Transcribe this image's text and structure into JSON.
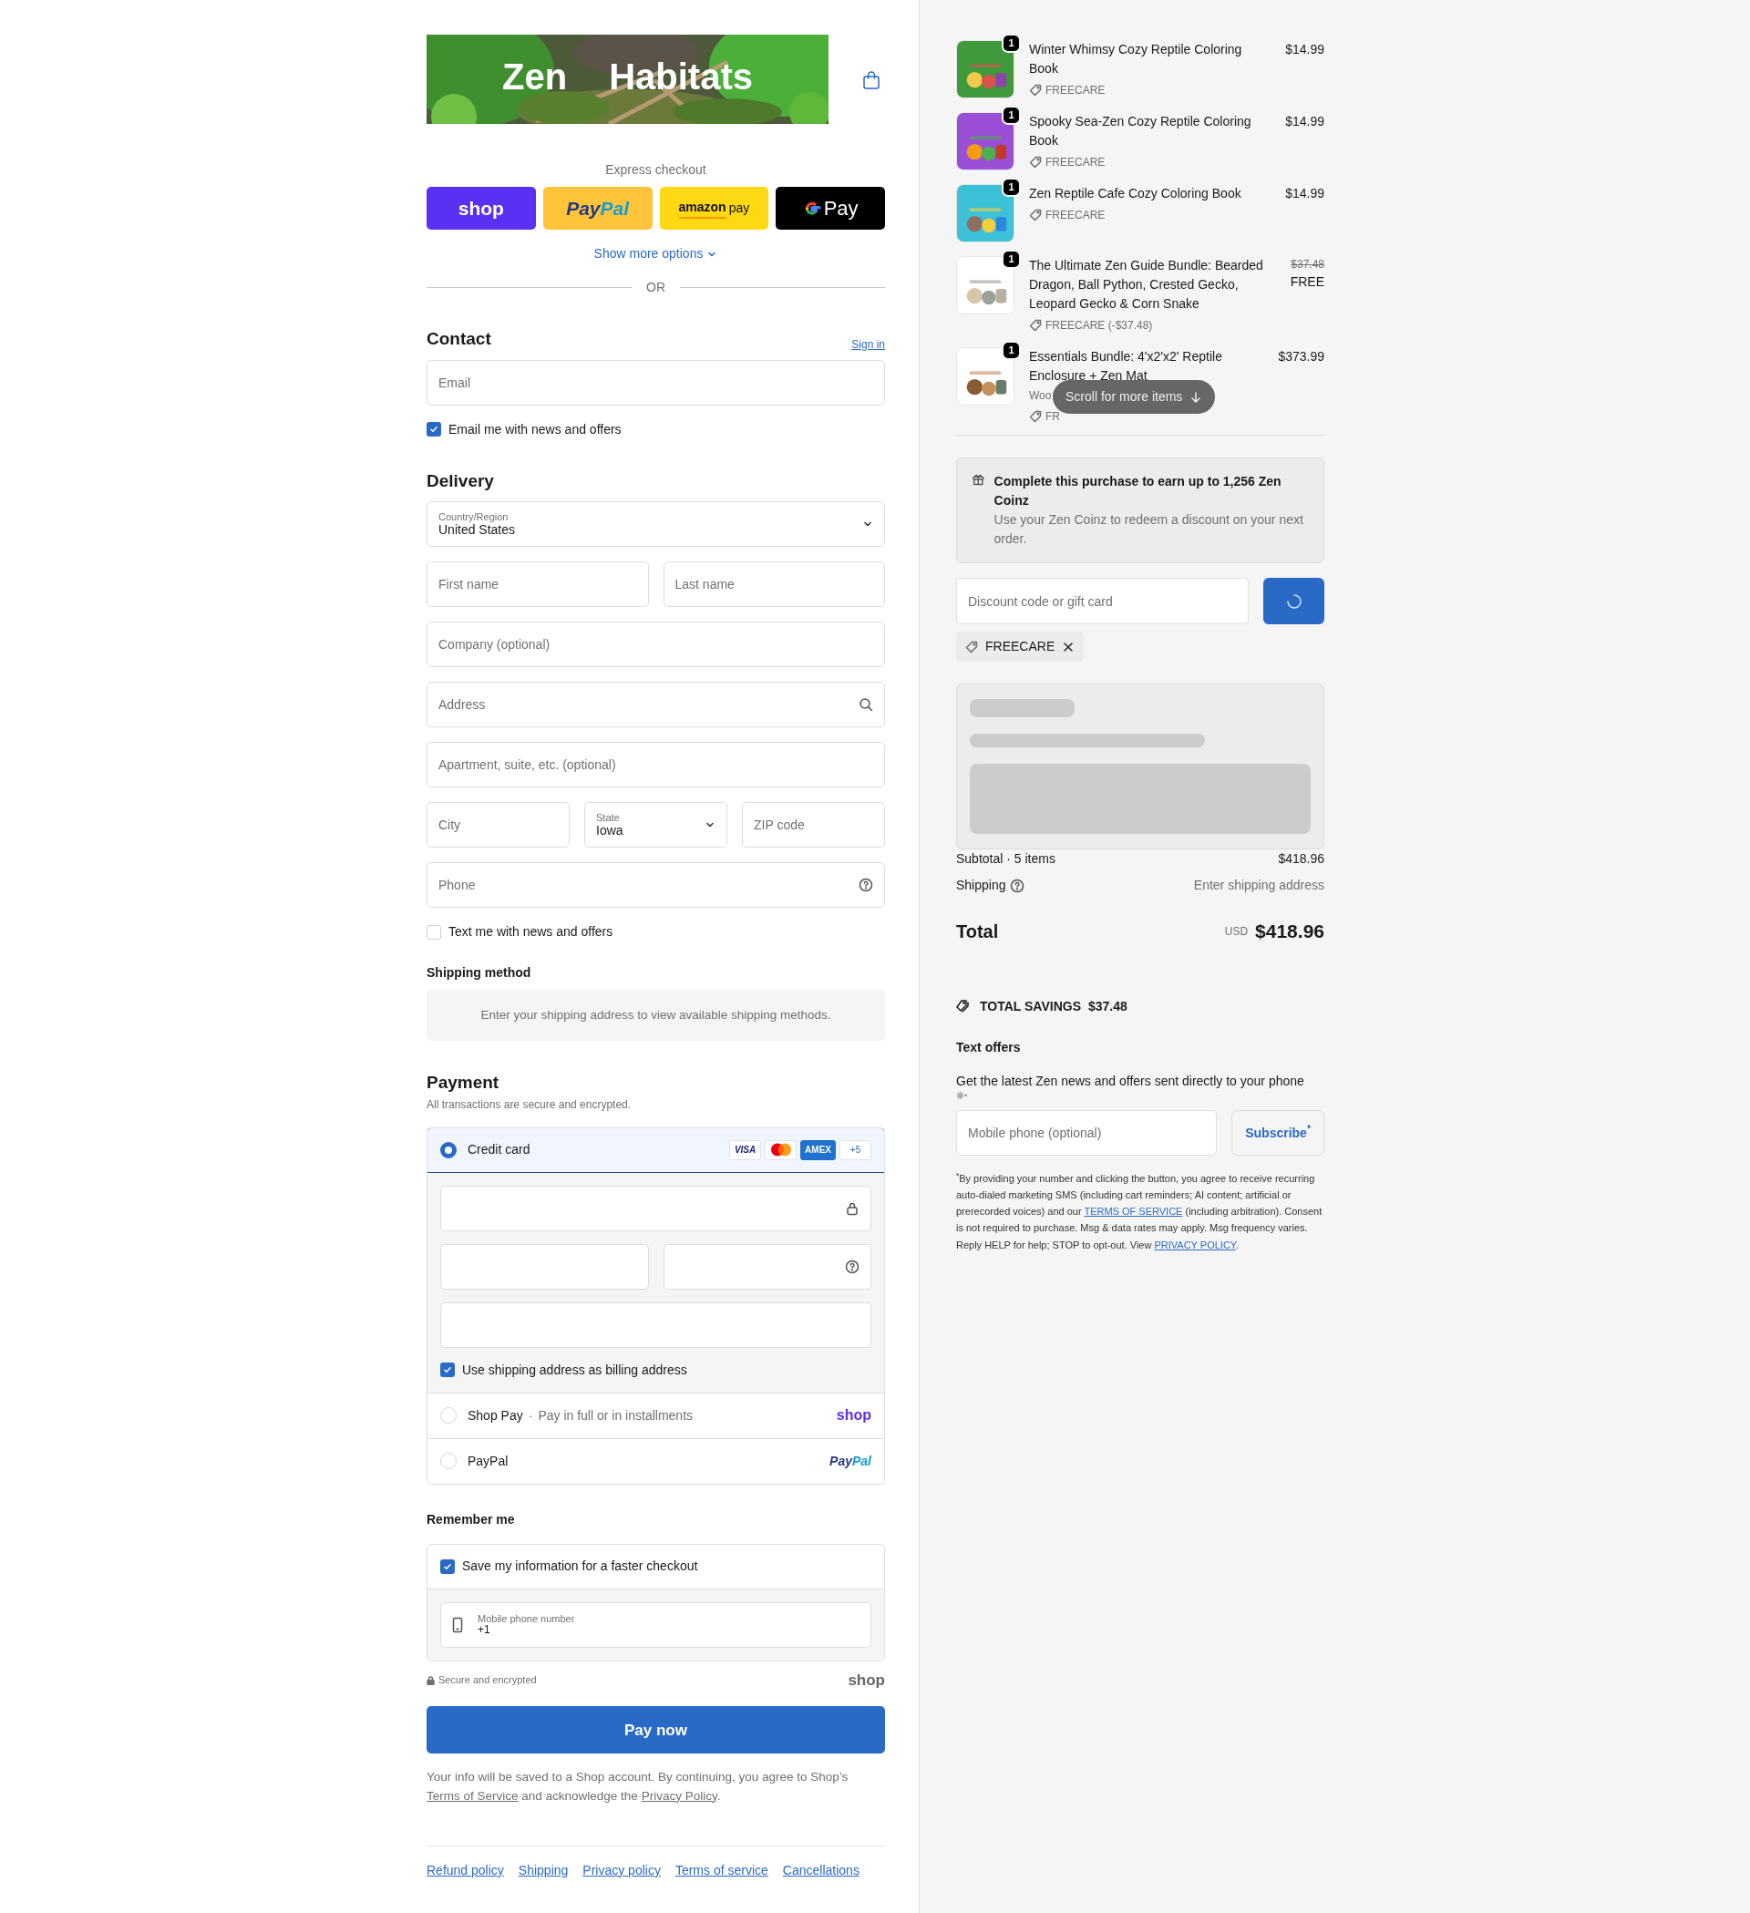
{
  "logo": {
    "words": [
      "Zen",
      "Habitats"
    ]
  },
  "express_checkout": {
    "title": "Express checkout",
    "buttons": [
      {
        "kind": "shop",
        "parts": [
          "shop"
        ]
      },
      {
        "kind": "paypal",
        "parts": [
          "Pay",
          "Pal"
        ]
      },
      {
        "kind": "amazon",
        "parts": [
          "amazon",
          "pay"
        ]
      },
      {
        "kind": "gpay",
        "parts": [
          "Pay"
        ]
      }
    ],
    "more": "Show more options",
    "divider": "OR"
  },
  "contact": {
    "title": "Contact",
    "sign_in": "Sign in",
    "email": {
      "placeholder": "Email"
    },
    "news": {
      "label": "Email me with news and offers",
      "checked": true
    }
  },
  "delivery": {
    "title": "Delivery",
    "rows": [
      [
        {
          "kind": "select",
          "label": "Country/Region",
          "value": "United States"
        }
      ],
      [
        {
          "kind": "text",
          "placeholder": "First name"
        },
        {
          "kind": "text",
          "placeholder": "Last name"
        }
      ],
      [
        {
          "kind": "text",
          "placeholder": "Company (optional)"
        }
      ],
      [
        {
          "kind": "search",
          "placeholder": "Address"
        }
      ],
      [
        {
          "kind": "text",
          "placeholder": "Apartment, suite, etc. (optional)"
        }
      ],
      [
        {
          "kind": "text",
          "placeholder": "City"
        },
        {
          "kind": "select",
          "label": "State",
          "value": "Iowa"
        },
        {
          "kind": "text",
          "placeholder": "ZIP code"
        }
      ],
      [
        {
          "kind": "help",
          "placeholder": "Phone"
        }
      ]
    ],
    "text_news": {
      "label": "Text me with news and offers",
      "checked": false
    }
  },
  "shipping_method": {
    "title": "Shipping method",
    "notice": "Enter your shipping address to view available shipping methods."
  },
  "payment": {
    "title": "Payment",
    "subtitle": "All transactions are secure and encrypted.",
    "methods": [
      {
        "kind": "card",
        "label": "Credit card",
        "selected": true,
        "brands": [
          {
            "kind": "visa",
            "label": "VISA"
          },
          {
            "kind": "mastercard"
          },
          {
            "kind": "amex",
            "label": "AMEX"
          },
          {
            "kind": "more",
            "label": "+5"
          }
        ],
        "fields": [
          [
            {
              "kind": "lock"
            }
          ],
          [
            {
              "kind": "plain"
            },
            {
              "kind": "help"
            }
          ],
          [
            {
              "kind": "plain"
            }
          ]
        ],
        "billing": {
          "label": "Use shipping address as billing address",
          "checked": true
        }
      },
      {
        "kind": "shoppay",
        "label": "Shop Pay",
        "separator": "·",
        "note": "Pay in full or in installments",
        "logo": [
          "shop"
        ],
        "selected": false
      },
      {
        "kind": "paypal",
        "label": "PayPal",
        "logo": [
          "Pay",
          "Pal"
        ],
        "selected": false
      }
    ]
  },
  "remember": {
    "title": "Remember me",
    "save": {
      "label": "Save my information for a faster checkout",
      "checked": true
    },
    "phone": {
      "label": "Mobile phone number",
      "value": "+1"
    }
  },
  "secure": "Secure and encrypted",
  "shop_logo": "shop",
  "pay_button": "Pay now",
  "legal": [
    {
      "kind": "text",
      "text": "Your info will be saved to a Shop account. By continuing, you agree to Shop’s "
    },
    {
      "kind": "link",
      "text": "Terms of Service"
    },
    {
      "kind": "text",
      "text": " and acknowledge the "
    },
    {
      "kind": "link",
      "text": "Privacy Policy"
    },
    {
      "kind": "text",
      "text": "."
    }
  ],
  "footer_links": [
    "Refund policy",
    "Shipping",
    "Privacy policy",
    "Terms of service",
    "Cancellations"
  ],
  "order": {
    "items": [
      {
        "title": "Winter Whimsy Cozy Reptile Coloring Book",
        "quantity": "1",
        "tag": "FREECARE",
        "price": "$14.99"
      },
      {
        "title": "Spooky Sea-Zen Cozy Reptile Coloring Book",
        "quantity": "1",
        "tag": "FREECARE",
        "price": "$14.99"
      },
      {
        "title": "Zen Reptile Cafe Cozy Coloring Book",
        "quantity": "1",
        "tag": "FREECARE",
        "price": "$14.99"
      },
      {
        "title": "The Ultimate Zen Guide Bundle: Bearded Dragon, Ball Python, Crested Gecko, Leopard Gecko & Corn Snake",
        "quantity": "1",
        "tag": "FREECARE (-$37.48)",
        "original_price": "$37.48",
        "price": "FREE"
      },
      {
        "title": "Essentials Bundle: 4'x2'x2' Reptile Enclosure + Zen Mat",
        "quantity": "1",
        "variant": "Woo",
        "tag": "FR",
        "price": "$373.99"
      }
    ],
    "scroll_hint": "Scroll for more items"
  },
  "rewards": {
    "title": "Complete this purchase to earn up to 1,256 Zen Coinz",
    "text": "Use your Zen Coinz to redeem a discount on your next order."
  },
  "discount": {
    "placeholder": "Discount code or gift card",
    "loading": true
  },
  "applied_codes": [
    {
      "code": "FREECARE"
    }
  ],
  "summary": {
    "loading": true,
    "subtotal_label": "Subtotal · 5 items",
    "subtotal": "$418.96",
    "shipping_label": "Shipping",
    "shipping": "Enter shipping address",
    "total_label": "Total",
    "currency": "USD",
    "total": "$418.96"
  },
  "savings": {
    "label": "TOTAL SAVINGS",
    "amount": "$37.48"
  },
  "text_offers": {
    "title": "Text offers",
    "text": "Get the latest Zen news and offers sent directly to your phone",
    "note_mark": "*",
    "phone": {
      "placeholder": "Mobile phone (optional)"
    },
    "button": "Subscribe$^{*}$",
    "disclaimer": [
      {
        "kind": "text",
        "text": "$^{*}$By providing your number and clicking the button, you agree to receive recurring auto-dialed marketing SMS (including cart reminders; AI content; artificial or prerecorded voices) and our "
      },
      {
        "kind": "link",
        "text": "TERMS OF SERVICE"
      },
      {
        "kind": "text",
        "text": " (including arbitration). Consent is not required to purchase. Msg & data rates may apply. Msg frequency varies. Reply HELP for help; STOP to opt-out. View "
      },
      {
        "kind": "link",
        "text": "PRIVACY POLICY"
      },
      {
        "kind": "text",
        "text": "."
      }
    ]
  }
}
